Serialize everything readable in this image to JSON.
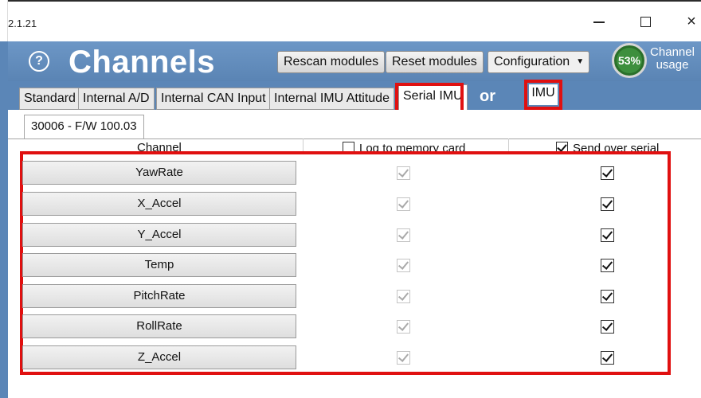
{
  "window": {
    "version": "2.1.21",
    "minimize_icon": "minimize-icon",
    "maximize_icon": "maximize-icon",
    "close_glyph": "×"
  },
  "header": {
    "help_glyph": "?",
    "title": "Channels",
    "rescan_label": "Rescan modules",
    "reset_label": "Reset modules",
    "configuration_label": "Configuration",
    "channel_usage_value": "53%",
    "channel_usage_label": "Channel usage"
  },
  "tabs": [
    {
      "label": "Standard"
    },
    {
      "label": "Internal A/D"
    },
    {
      "label": "Internal CAN Input"
    },
    {
      "label": "Internal IMU Attitude"
    },
    {
      "label": "Serial IMU"
    }
  ],
  "selected_tab": "Serial IMU",
  "or_text": "or",
  "imu_tab_label": "IMU",
  "module_tab": "30006 - F/W 100.03",
  "columns": {
    "channel": "Channel",
    "log": "Log to memory card",
    "send": "Send over serial"
  },
  "header_checks": {
    "log": false,
    "send": true
  },
  "rows": [
    {
      "name": "YawRate",
      "log": true,
      "send": true
    },
    {
      "name": "X_Accel",
      "log": true,
      "send": true
    },
    {
      "name": "Y_Accel",
      "log": true,
      "send": true
    },
    {
      "name": "Temp",
      "log": true,
      "send": true
    },
    {
      "name": "PitchRate",
      "log": true,
      "send": true
    },
    {
      "name": "RollRate",
      "log": true,
      "send": true
    },
    {
      "name": "Z_Accel",
      "log": true,
      "send": true
    }
  ],
  "colors": {
    "header_blue": "#5b86b7",
    "highlight_red": "#e01010",
    "gauge_green": "#3d8f3d"
  }
}
